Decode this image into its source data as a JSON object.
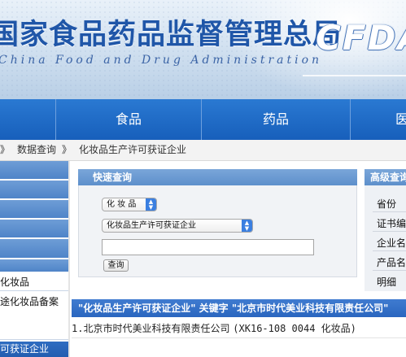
{
  "banner": {
    "agency_cn": "国家食品药品监督管理总局",
    "agency_en": "China Food and Drug Administration",
    "logo": "CFDA"
  },
  "nav": {
    "items": [
      {
        "label": "食品"
      },
      {
        "label": "药品"
      },
      {
        "label": "医"
      }
    ]
  },
  "breadcrumb": {
    "sep": "》",
    "data_query": "数据查询",
    "current": "化妆品生产许可获证企业"
  },
  "sidebar": {
    "items": [
      {
        "label": "化妆品"
      },
      {
        "label": "途化妆品备案"
      },
      {
        "label": "可获证企业"
      }
    ]
  },
  "quick_query": {
    "title": "快速查询",
    "category_select": "化 妆 品",
    "dataset_select": "化妆品生产许可获证企业",
    "search_value": "",
    "button": "查询"
  },
  "advanced": {
    "title": "高级查询",
    "fields": [
      {
        "label": "省份"
      },
      {
        "label": "证书编号"
      },
      {
        "label": "企业名称"
      },
      {
        "label": "产品名称"
      },
      {
        "label": "明细"
      }
    ]
  },
  "results": {
    "header": "\"化妆品生产许可获证企业\" 关键字 \"北京市时代美业科技有限责任公司\"",
    "rows": [
      {
        "index": "1.",
        "name": "北京市时代美业科技有限责任公司",
        "detail": "(XK16-108 0044 化妆品)"
      }
    ]
  }
}
